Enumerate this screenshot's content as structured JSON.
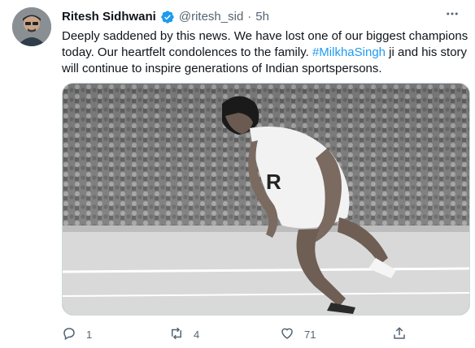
{
  "tweet": {
    "author_name": "Ritesh Sidhwani",
    "handle": "@ritesh_sid",
    "separator": "·",
    "time": "5h",
    "text_before": "Deeply saddened by this news. We have lost one of our biggest champions today. Our heartfelt condolences to the family. ",
    "hashtag": "#MilkhaSingh",
    "text_after": " ji and his story will continue to inspire generations of Indian sportspersons.",
    "image_alt": "Black and white photo of an athlete sprinting in a stadium",
    "icons": {
      "verified": "verified-badge-icon",
      "more": "more-icon",
      "reply": "reply-icon",
      "retweet": "retweet-icon",
      "like": "like-icon",
      "share": "share-icon"
    },
    "counts": {
      "reply": "1",
      "retweet": "4",
      "like": "71"
    },
    "colors": {
      "link": "#1d9bf0",
      "muted": "#536471",
      "text": "#0f1419"
    }
  }
}
